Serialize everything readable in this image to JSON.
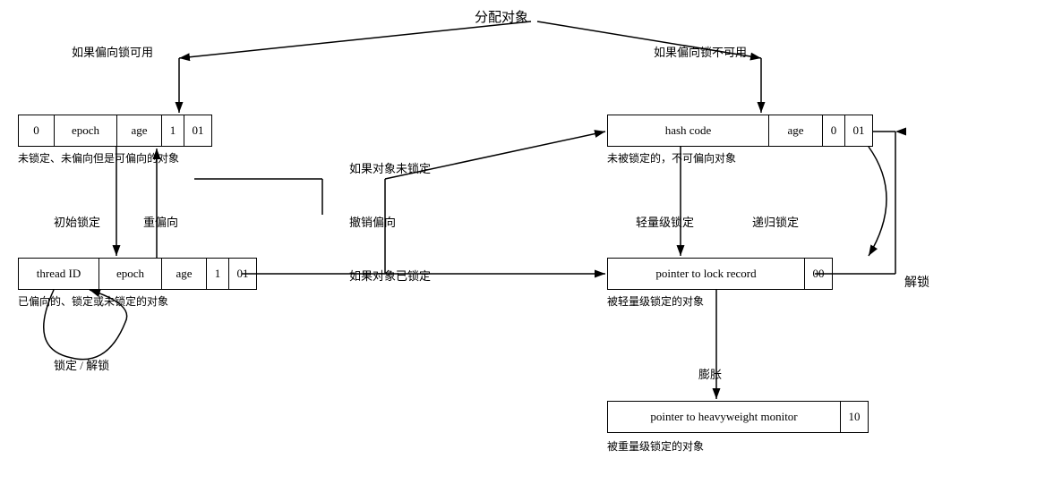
{
  "title": "分配对象",
  "left_condition": "如果偏向锁可用",
  "right_condition": "如果偏向锁不可用",
  "box1": {
    "cells": [
      "0",
      "epoch",
      "age",
      "1",
      "01"
    ],
    "widths": [
      40,
      70,
      50,
      25,
      30
    ]
  },
  "box1_label": "未锁定、未偏向但是可偏向的对象",
  "box2": {
    "cells": [
      "thread ID",
      "epoch",
      "age",
      "1",
      "01"
    ],
    "widths": [
      80,
      70,
      50,
      25,
      30
    ]
  },
  "box2_label": "已偏向的、锁定或未锁定的对象",
  "box3": {
    "cells": [
      "hash code",
      "age",
      "0",
      "01"
    ],
    "widths": [
      180,
      60,
      25,
      30
    ]
  },
  "box3_label": "未被锁定的，不可偏向对象",
  "box4": {
    "cells": [
      "pointer to lock record",
      "00"
    ],
    "widths": [
      220,
      30
    ]
  },
  "box4_label": "被轻量级锁定的对象",
  "box5": {
    "cells": [
      "pointer to heavyweight monitor",
      "10"
    ],
    "widths": [
      260,
      30
    ]
  },
  "box5_label": "被重量级锁定的对象",
  "label_init_lock": "初始锁定",
  "label_rebias": "重偏向",
  "label_lock_unlock": "锁定 / 解锁",
  "label_if_unlocked": "如果对象未锁定",
  "label_if_locked": "如果对象已锁定",
  "label_revoke": "撤销偏向",
  "label_lightweight": "轻量级锁定",
  "label_recursive": "递归锁定",
  "label_inflate": "膨胀",
  "label_unlock": "解锁"
}
